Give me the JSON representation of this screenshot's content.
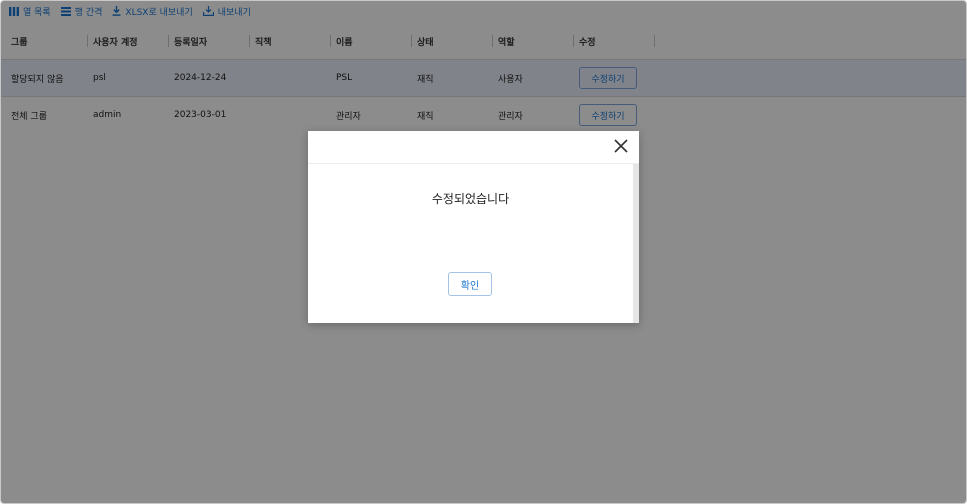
{
  "toolbar": {
    "columns_label": "열 목록",
    "density_label": "행 간격",
    "export_xlsx_label": "XLSX로 내보내기",
    "export_label": "내보내기"
  },
  "table": {
    "headers": [
      "그룹",
      "사용자 계정",
      "등록일자",
      "직책",
      "이름",
      "상태",
      "역할",
      "수정"
    ],
    "rows": [
      {
        "group": "할당되지 않음",
        "account": "psl",
        "date": "2024-12-24",
        "position": "",
        "name": "PSL",
        "status": "재직",
        "role": "사용자",
        "edit_label": "수정하기"
      },
      {
        "group": "전체 그룹",
        "account": "admin",
        "date": "2023-03-01",
        "position": "",
        "name": "관리자",
        "status": "재직",
        "role": "관리자",
        "edit_label": "수정하기"
      }
    ]
  },
  "modal": {
    "message": "수정되었습니다",
    "confirm_label": "확인"
  },
  "colors": {
    "accent": "#1976d2",
    "selected_row": "#e9eefa",
    "overlay": "rgba(0,0,0,0.45)"
  }
}
